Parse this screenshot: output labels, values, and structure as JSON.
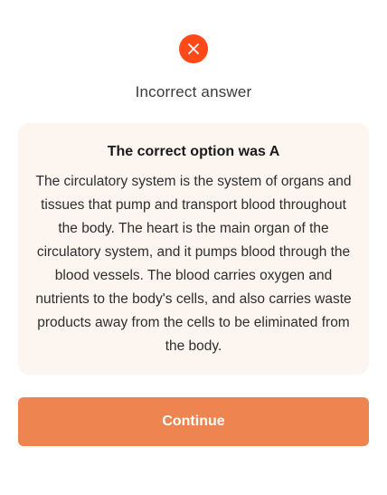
{
  "status": {
    "icon": "close-icon",
    "icon_color": "#ff4a17",
    "title": "Incorrect answer"
  },
  "explanation": {
    "heading": "The correct option was A",
    "body": "The circulatory system is the system of organs and tissues that pump and transport blood throughout the body. The heart is the main organ of the circulatory system, and it pumps blood through the blood vessels. The blood carries oxygen and nutrients to the body's cells, and also carries waste products away from the cells to be eliminated from the body.",
    "background_color": "#fdf5ef"
  },
  "actions": {
    "continue_label": "Continue",
    "continue_color": "#ee8550"
  }
}
